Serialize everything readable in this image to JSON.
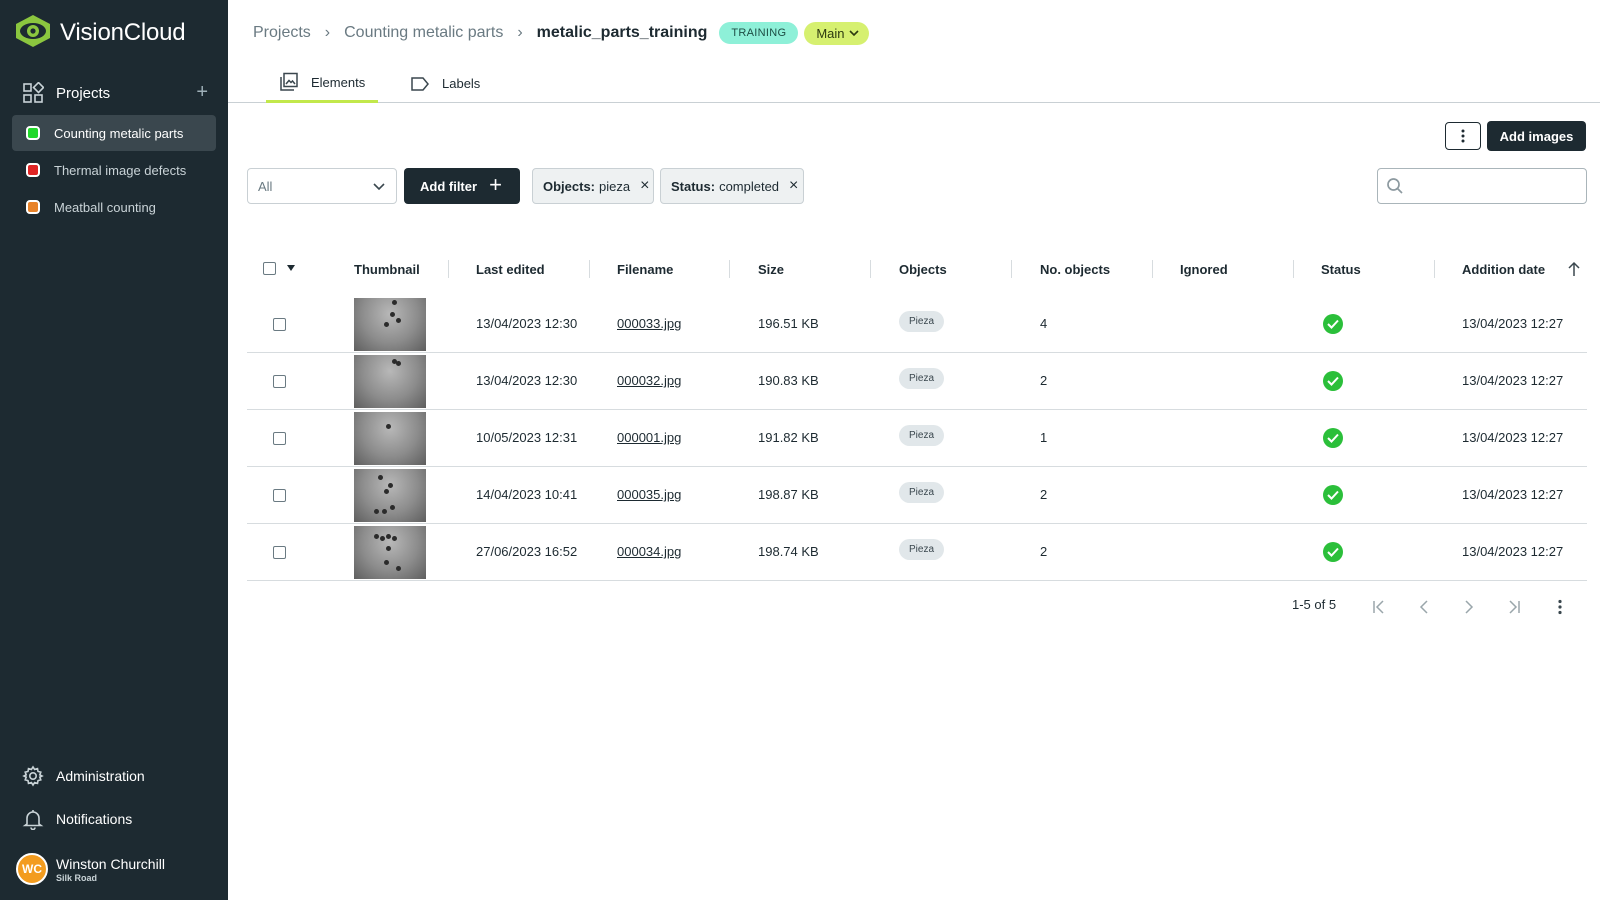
{
  "app": {
    "brand_name": "VisionCloud",
    "accent_color": "#c2e84b",
    "sidebar_color": "#1d2a31"
  },
  "sidebar": {
    "projects_label": "Projects",
    "projects": [
      {
        "label": "Counting metalic parts",
        "color": "#22d82c",
        "active": true
      },
      {
        "label": "Thermal image defects",
        "color": "#e02525",
        "active": false
      },
      {
        "label": "Meatball counting",
        "color": "#e8832a",
        "active": false
      }
    ],
    "administration_label": "Administration",
    "notifications_label": "Notifications",
    "user": {
      "initials": "WC",
      "name": "Winston Churchill",
      "org": "Silk Road"
    }
  },
  "header": {
    "breadcrumb": [
      "Projects",
      "Counting metalic parts",
      "metalic_parts_training"
    ],
    "stage_badge": "TRAINING",
    "branch_label": "Main",
    "tabs": [
      {
        "label": "Elements",
        "icon": "images-icon",
        "active": true
      },
      {
        "label": "Labels",
        "icon": "label-tag-icon",
        "active": false
      }
    ]
  },
  "toolbar": {
    "add_images_label": "Add images",
    "select_value": "All",
    "add_filter_label": "Add filter",
    "filters": [
      {
        "key": "Objects:",
        "value": "pieza"
      },
      {
        "key": "Status:",
        "value": "completed"
      }
    ],
    "search_placeholder": ""
  },
  "table": {
    "columns": [
      "Thumbnail",
      "Last edited",
      "Filename",
      "Size",
      "Objects",
      "No. objects",
      "Ignored",
      "Status",
      "Addition date"
    ],
    "sort_column": "Addition date",
    "sort_direction": "ascending",
    "rows": [
      {
        "last_edited": "13/04/2023 12:30",
        "filename": "000033.jpg",
        "size": "196.51 KB",
        "objects": "Pieza",
        "no_objects": "4",
        "ignored": "",
        "status": "completed",
        "addition_date": "13/04/2023 12:27"
      },
      {
        "last_edited": "13/04/2023 12:30",
        "filename": "000032.jpg",
        "size": "190.83 KB",
        "objects": "Pieza",
        "no_objects": "2",
        "ignored": "",
        "status": "completed",
        "addition_date": "13/04/2023 12:27"
      },
      {
        "last_edited": "10/05/2023 12:31",
        "filename": "000001.jpg",
        "size": "191.82 KB",
        "objects": "Pieza",
        "no_objects": "1",
        "ignored": "",
        "status": "completed",
        "addition_date": "13/04/2023 12:27"
      },
      {
        "last_edited": "14/04/2023 10:41",
        "filename": "000035.jpg",
        "size": "198.87 KB",
        "objects": "Pieza",
        "no_objects": "2",
        "ignored": "",
        "status": "completed",
        "addition_date": "13/04/2023 12:27"
      },
      {
        "last_edited": "27/06/2023 16:52",
        "filename": "000034.jpg",
        "size": "198.74 KB",
        "objects": "Pieza",
        "no_objects": "2",
        "ignored": "",
        "status": "completed",
        "addition_date": "13/04/2023 12:27"
      }
    ]
  },
  "pagination": {
    "range_text": "1-5 of 5"
  }
}
